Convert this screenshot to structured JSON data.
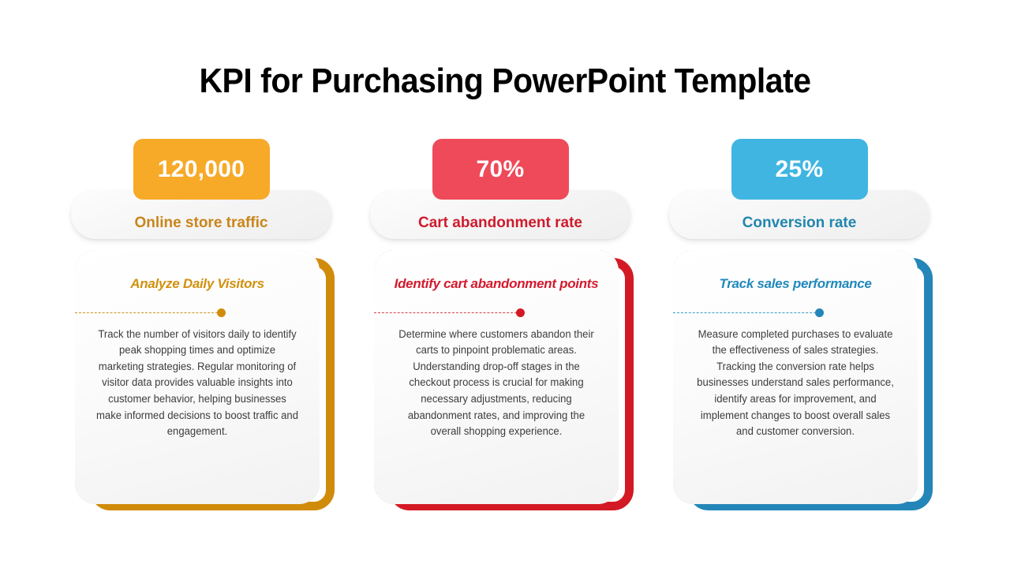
{
  "slide": {
    "title": "KPI for Purchasing PowerPoint Template",
    "background_color": "#FFFFFF"
  },
  "columns": [
    {
      "id": "online-store-traffic",
      "badge_value": "120,000",
      "badge_color": "#F7A928",
      "label": "Online store traffic",
      "label_color": "#C9851A",
      "accent_solid": "#D18B0B",
      "accent_dashed": "#C9951F",
      "dot_color": "#D18B0B",
      "heading": "Analyze Daily Visitors",
      "heading_color": "#D1910F",
      "body": "Track the number of visitors daily to identify peak shopping times and optimize marketing strategies. Regular monitoring of visitor data provides valuable insights into customer behavior, helping businesses make informed decisions to boost traffic and engagement."
    },
    {
      "id": "cart-abandonment-rate",
      "badge_value": "70%",
      "badge_color": "#EF4A59",
      "label": "Cart abandonment rate",
      "label_color": "#CE1B2D",
      "accent_solid": "#D31A24",
      "accent_dashed": "#D4414C",
      "dot_color": "#D31A24",
      "heading": "Identify cart abandonment points",
      "heading_color": "#D31A2E",
      "body": "Determine where customers abandon their carts to pinpoint problematic areas. Understanding drop-off stages in the checkout process is crucial for making necessary adjustments, reducing abandonment rates, and improving the overall shopping experience."
    },
    {
      "id": "conversion-rate",
      "badge_value": "25%",
      "badge_color": "#40B5E2",
      "label": "Conversion rate",
      "label_color": "#2186AE",
      "accent_solid": "#2486B8",
      "accent_dashed": "#3C9DC6",
      "dot_color": "#2486B8",
      "heading": "Track sales performance",
      "heading_color": "#2189BC",
      "body": "Measure completed purchases to evaluate the effectiveness of sales strategies. Tracking the conversion rate helps businesses understand sales performance, identify areas for improvement, and implement changes to boost overall sales and customer conversion."
    }
  ]
}
